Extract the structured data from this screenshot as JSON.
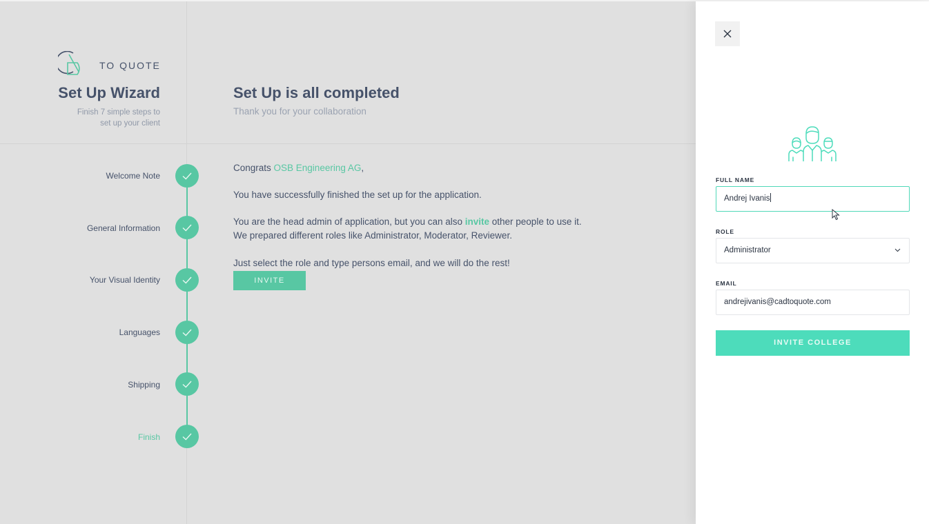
{
  "brand": {
    "logo_text": "TO QUOTE"
  },
  "wizard": {
    "title": "Set Up Wizard",
    "subtitle_line1": "Finish 7 simple steps to",
    "subtitle_line2": "set up your client"
  },
  "steps": [
    {
      "label": "Welcome Note",
      "done": true
    },
    {
      "label": "General Information",
      "done": true
    },
    {
      "label": "Your Visual Identity",
      "done": true
    },
    {
      "label": "Languages",
      "done": true
    },
    {
      "label": "Shipping",
      "done": true
    },
    {
      "label": "Finish",
      "done": true,
      "active": true
    }
  ],
  "main": {
    "title": "Set Up is all completed",
    "subtitle": "Thank you for your collaboration",
    "congrats_prefix": "Congrats ",
    "company": "OSB Engineering AG",
    "congrats_suffix": ",",
    "line_success": "You have successfully finished the set up for the application.",
    "line_admin_prefix": "You are the head admin of application, but you can also ",
    "line_admin_link": "invite",
    "line_admin_suffix": " other people to use it.",
    "line_roles": "We prepared different roles like Administrator, Moderator, Reviewer.",
    "line_select": "Just select the role and type persons email, and we will do the rest!",
    "invite_button": "INVITE"
  },
  "panel": {
    "full_name_label": "FULL NAME",
    "full_name_value": "Andrej Ivanis",
    "role_label": "ROLE",
    "role_value": "Administrator",
    "email_label": "EMAIL",
    "email_value": "andrejivanis@cadtoquote.com",
    "submit_button": "INVITE COLLEGE"
  },
  "colors": {
    "accent": "#58c7a3",
    "panel_button": "#4ddcbb",
    "text_dark": "#46526a",
    "overlay_bg": "#e0e0e0"
  },
  "icons": {
    "close": "close-icon",
    "people": "people-group-icon",
    "check": "check-icon",
    "chevron": "chevron-down-icon"
  }
}
